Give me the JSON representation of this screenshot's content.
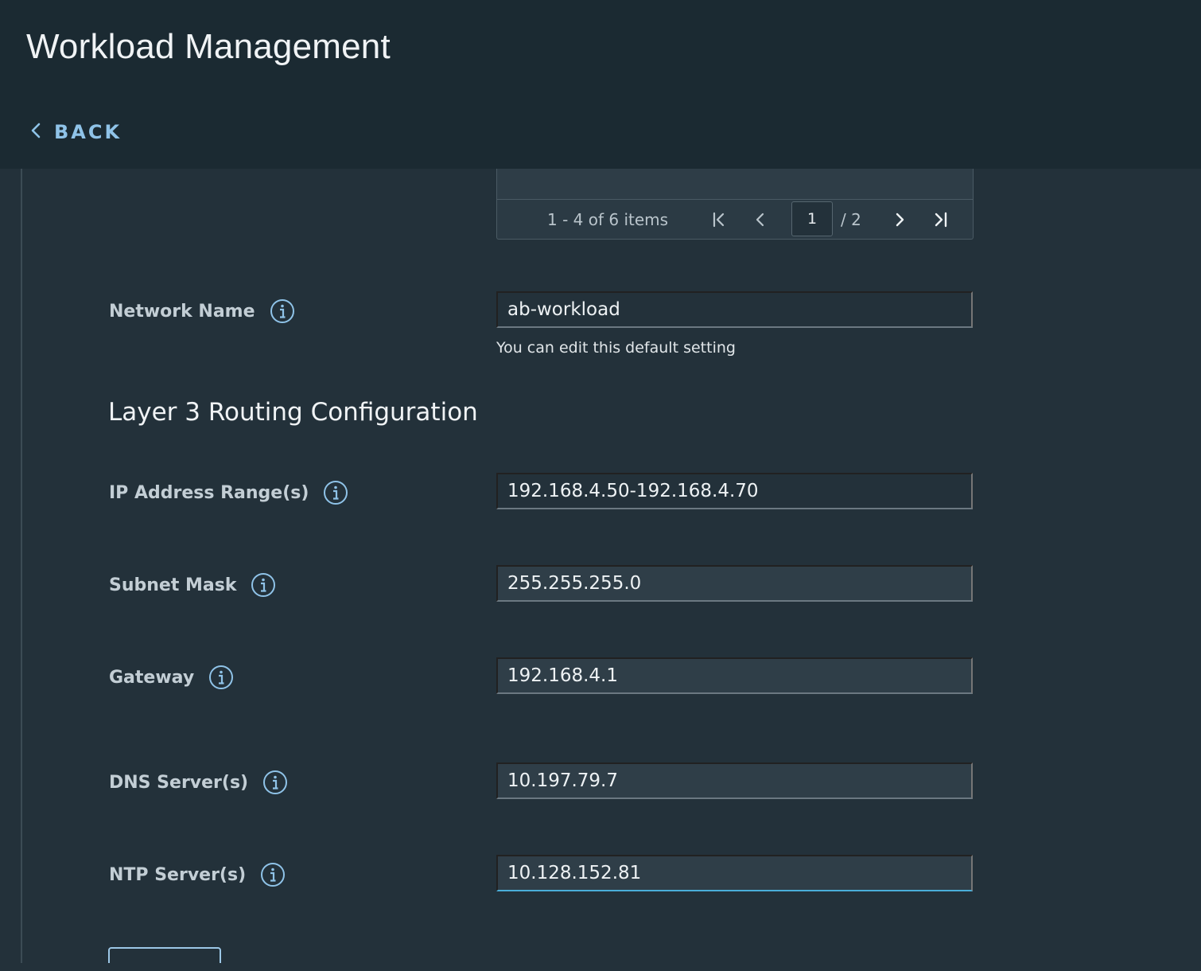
{
  "header": {
    "title": "Workload Management",
    "back_label": "BACK"
  },
  "pagination": {
    "summary": "1 - 4 of 6 items",
    "current_page": "1",
    "total_pages": "/ 2"
  },
  "form": {
    "network_name": {
      "label": "Network Name",
      "value": "ab-workload",
      "helper": "You can edit this default setting"
    },
    "section_title": "Layer 3 Routing Configuration",
    "ip_range": {
      "label": "IP Address Range(s)",
      "value": "192.168.4.50-192.168.4.70"
    },
    "subnet_mask": {
      "label": "Subnet Mask",
      "value": "255.255.255.0"
    },
    "gateway": {
      "label": "Gateway",
      "value": "192.168.4.1"
    },
    "dns_servers": {
      "label": "DNS Server(s)",
      "value": "10.197.79.7"
    },
    "ntp_servers": {
      "label": "NTP Server(s)",
      "value": "10.128.152.81"
    }
  },
  "icons": {
    "back": "chevron-left-icon",
    "info": "info-circle-icon",
    "first_page": "page-first-icon",
    "prev_page": "chevron-left-icon",
    "next_page": "chevron-right-icon",
    "last_page": "page-last-icon"
  },
  "colors": {
    "header_bg": "#1b2a32",
    "content_bg": "#23313a",
    "link": "#8fc3e8",
    "focus_underline": "#4aaed9"
  }
}
